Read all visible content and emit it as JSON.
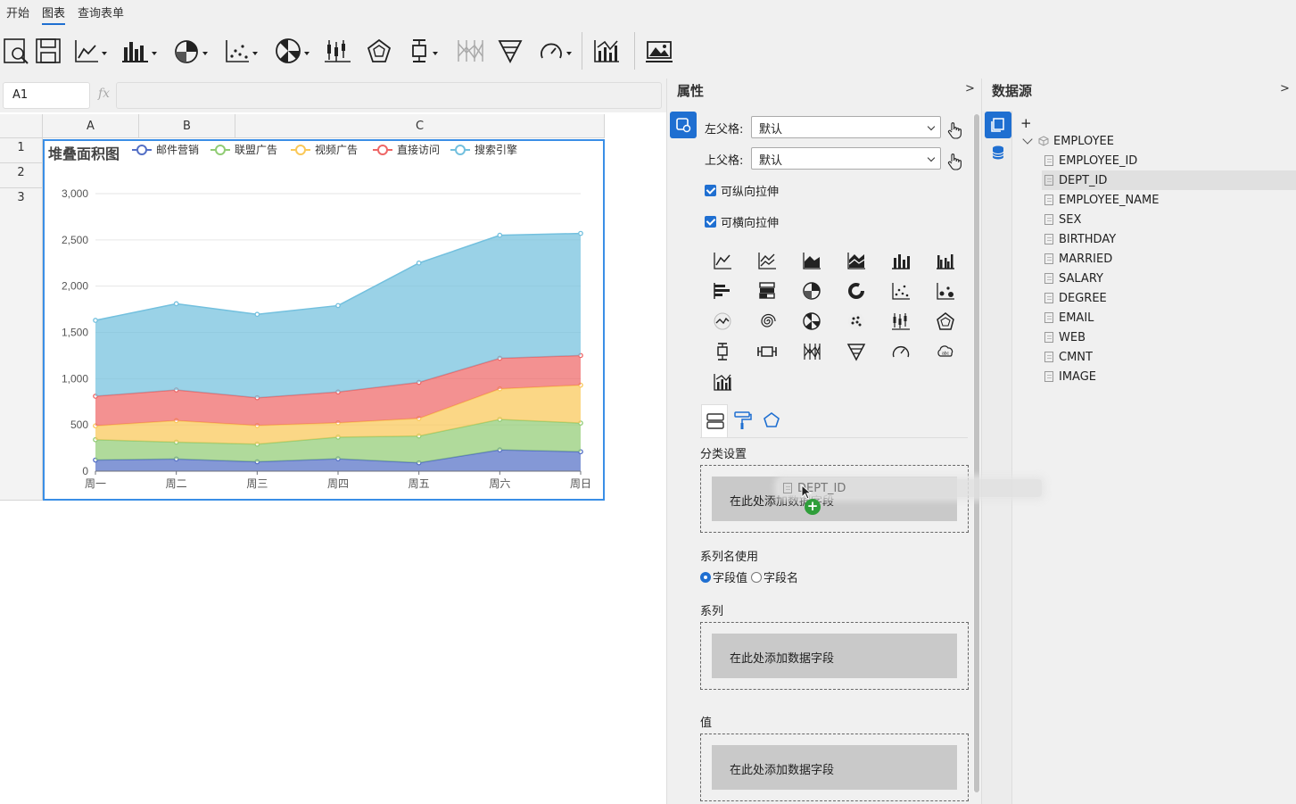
{
  "menu": {
    "tabs": [
      "开始",
      "图表",
      "查询表单"
    ],
    "active": "图表"
  },
  "formula_bar": {
    "cell_ref": "A1",
    "fx_label": "fx",
    "formula": ""
  },
  "grid": {
    "columns": [
      "A",
      "B",
      "C"
    ],
    "rows": [
      "1",
      "2",
      "3"
    ]
  },
  "chart_data": {
    "type": "area",
    "stacked": true,
    "title": "堆叠面积图",
    "categories": [
      "周一",
      "周二",
      "周三",
      "周四",
      "周五",
      "周六",
      "周日"
    ],
    "ylim": [
      0,
      3000
    ],
    "yticks": [
      "0",
      "500",
      "1,000",
      "1,500",
      "2,000",
      "2,500",
      "3,000"
    ],
    "grid": true,
    "legend_position": "top",
    "series": [
      {
        "name": "邮件营销",
        "color": "#5470c6",
        "values": [
          120,
          132,
          101,
          134,
          90,
          230,
          210
        ]
      },
      {
        "name": "联盟广告",
        "color": "#91cc75",
        "values": [
          220,
          182,
          191,
          234,
          290,
          330,
          310
        ]
      },
      {
        "name": "视频广告",
        "color": "#fac858",
        "values": [
          150,
          232,
          201,
          154,
          190,
          330,
          410
        ]
      },
      {
        "name": "直接访问",
        "color": "#ee6666",
        "values": [
          320,
          332,
          301,
          334,
          390,
          330,
          320
        ]
      },
      {
        "name": "搜索引擎",
        "color": "#73c0de",
        "values": [
          820,
          932,
          901,
          934,
          1290,
          1330,
          1320
        ]
      }
    ]
  },
  "properties": {
    "title": "属性",
    "collapse": ">",
    "left_parent_label": "左父格:",
    "left_parent_value": "默认",
    "top_parent_label": "上父格:",
    "top_parent_value": "默认",
    "stretch_v": "可纵向拉伸",
    "stretch_h": "可横向拉伸",
    "category_label": "分类设置",
    "series_name_label": "系列名使用",
    "radio_field_value": "字段值",
    "radio_field_name": "字段名",
    "series_label": "系列",
    "value_label": "值",
    "dropzone_text": "在此处添加数据字段"
  },
  "datasource": {
    "title": "数据源",
    "collapse": ">",
    "add": "+",
    "table": "EMPLOYEE",
    "fields": [
      "EMPLOYEE_ID",
      "DEPT_ID",
      "EMPLOYEE_NAME",
      "SEX",
      "BIRTHDAY",
      "MARRIED",
      "SALARY",
      "DEGREE",
      "EMAIL",
      "WEB",
      "CMNT",
      "IMAGE"
    ],
    "selected": "DEPT_ID"
  },
  "drag": {
    "field": "DEPT_ID",
    "plus": "+"
  }
}
